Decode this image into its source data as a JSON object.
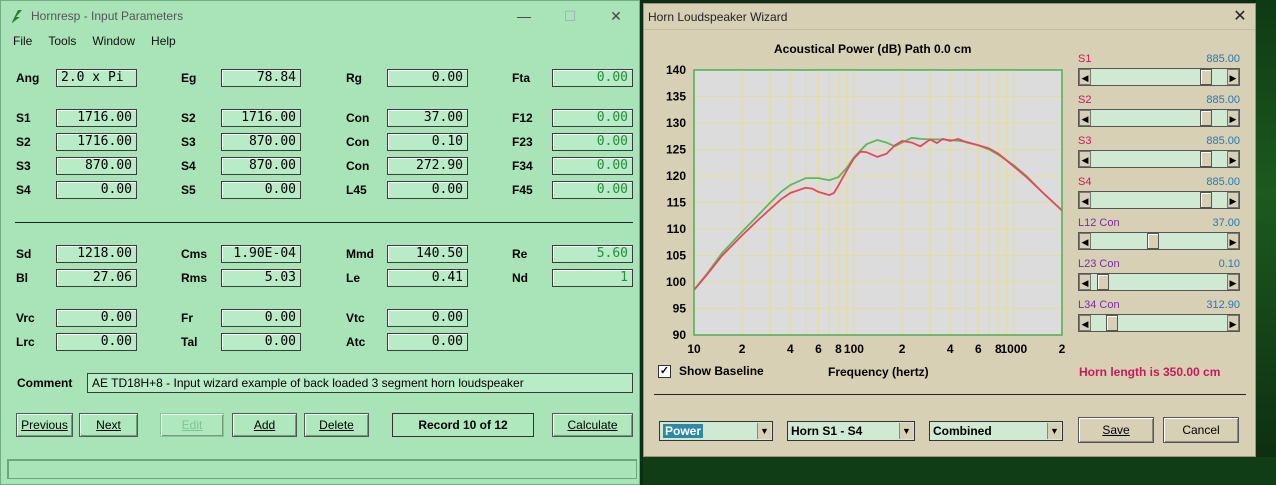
{
  "left_window": {
    "title": "Hornresp - Input Parameters",
    "controls": {
      "minimize": "—",
      "maximize": "☐",
      "close": "✕"
    },
    "menu": [
      "File",
      "Tools",
      "Window",
      "Help"
    ],
    "fields": [
      {
        "label": "Ang",
        "value": "2.0 x Pi"
      },
      {
        "label": "Eg",
        "value": "78.84"
      },
      {
        "label": "Rg",
        "value": "0.00"
      },
      {
        "label": "Fta",
        "value": "0.00"
      },
      {
        "label": "S1",
        "value": "1716.00"
      },
      {
        "label": "S2",
        "value": "1716.00"
      },
      {
        "label": "Con",
        "value": "37.00"
      },
      {
        "label": "F12",
        "value": "0.00"
      },
      {
        "label": "S2",
        "value": "1716.00"
      },
      {
        "label": "S3",
        "value": "870.00"
      },
      {
        "label": "Con",
        "value": "0.10"
      },
      {
        "label": "F23",
        "value": "0.00"
      },
      {
        "label": "S3",
        "value": "870.00"
      },
      {
        "label": "S4",
        "value": "870.00"
      },
      {
        "label": "Con",
        "value": "272.90"
      },
      {
        "label": "F34",
        "value": "0.00"
      },
      {
        "label": "S4",
        "value": "0.00"
      },
      {
        "label": "S5",
        "value": "0.00"
      },
      {
        "label": "L45",
        "value": "0.00"
      },
      {
        "label": "F45",
        "value": "0.00"
      },
      {
        "label": "Sd",
        "value": "1218.00"
      },
      {
        "label": "Cms",
        "value": "1.90E-04"
      },
      {
        "label": "Mmd",
        "value": "140.50"
      },
      {
        "label": "Re",
        "value": "5.60"
      },
      {
        "label": "Bl",
        "value": "27.06"
      },
      {
        "label": "Rms",
        "value": "5.03"
      },
      {
        "label": "Le",
        "value": "0.41"
      },
      {
        "label": "Nd",
        "value": "1"
      },
      {
        "label": "Vrc",
        "value": "0.00"
      },
      {
        "label": "Fr",
        "value": "0.00"
      },
      {
        "label": "Vtc",
        "value": "0.00"
      },
      {
        "label": "Lrc",
        "value": "0.00"
      },
      {
        "label": "Tal",
        "value": "0.00"
      },
      {
        "label": "Atc",
        "value": "0.00"
      }
    ],
    "comment_label": "Comment",
    "comment": "AE TD18H+8 - Input wizard example of back loaded 3 segment horn loudspeaker",
    "buttons": {
      "previous": "Previous",
      "next": "Next",
      "edit": "Edit",
      "add": "Add",
      "delete": "Delete",
      "calculate": "Calculate"
    },
    "record": "Record 10 of 12"
  },
  "right_window": {
    "title": "Horn Loudspeaker Wizard",
    "close": "✕",
    "chart_heading": "Acoustical Power (dB)   Path 0.0 cm",
    "show_baseline": "Show Baseline",
    "show_baseline_checked": "✓",
    "frequency_label": "Frequency (hertz)",
    "horn_length": "Horn length is 350.00 cm",
    "sliders": [
      {
        "label": "S1",
        "value": "885.00",
        "position": 0.88
      },
      {
        "label": "S2",
        "value": "885.00",
        "position": 0.88
      },
      {
        "label": "S3",
        "value": "885.00",
        "position": 0.88
      },
      {
        "label": "S4",
        "value": "885.00",
        "position": 0.88
      },
      {
        "label": "L12  Con",
        "value": "37.00",
        "position": 0.45
      },
      {
        "label": "L23  Con",
        "value": "0.10",
        "position": 0.05
      },
      {
        "label": "L34  Con",
        "value": "312.90",
        "position": 0.12
      }
    ],
    "combos": {
      "plot": "Power",
      "section": "Horn S1 - S4",
      "mode": "Combined"
    },
    "buttons": {
      "save": "Save",
      "cancel": "Cancel"
    },
    "arrows": {
      "left": "◀",
      "right": "▶",
      "down": "▼"
    },
    "colors": {
      "series_green": "#5cb85c",
      "series_red": "#e8465a",
      "grid": "#e4dc9c",
      "plot_bg": "#dcdcdc",
      "frame": "#4caf50"
    }
  },
  "chart_data": {
    "type": "line",
    "xscale": "log",
    "xlim": [
      10,
      2000
    ],
    "ylim": [
      90,
      140
    ],
    "xticks": [
      {
        "v": 10,
        "label": "10"
      },
      {
        "v": 20,
        "label": "2"
      },
      {
        "v": 40,
        "label": "4"
      },
      {
        "v": 60,
        "label": "6"
      },
      {
        "v": 80,
        "label": "8"
      },
      {
        "v": 100,
        "label": "100"
      },
      {
        "v": 200,
        "label": "2"
      },
      {
        "v": 400,
        "label": "4"
      },
      {
        "v": 600,
        "label": "6"
      },
      {
        "v": 800,
        "label": "8"
      },
      {
        "v": 1000,
        "label": "1000"
      },
      {
        "v": 2000,
        "label": "2"
      }
    ],
    "yticks": [
      90,
      95,
      100,
      105,
      110,
      115,
      120,
      125,
      130,
      135,
      140
    ],
    "series": [
      {
        "color": "#5cb85c",
        "points": [
          [
            10,
            98.5
          ],
          [
            12,
            101.5
          ],
          [
            15,
            105.5
          ],
          [
            20,
            109.5
          ],
          [
            25,
            112.5
          ],
          [
            30,
            115
          ],
          [
            35,
            117
          ],
          [
            40,
            118.3
          ],
          [
            50,
            119.6
          ],
          [
            60,
            119.6
          ],
          [
            70,
            119.2
          ],
          [
            80,
            119.8
          ],
          [
            90,
            121.5
          ],
          [
            100,
            123.5
          ],
          [
            120,
            126
          ],
          [
            140,
            126.8
          ],
          [
            160,
            126.3
          ],
          [
            180,
            125.6
          ],
          [
            200,
            126.3
          ],
          [
            230,
            127.2
          ],
          [
            260,
            127
          ],
          [
            300,
            126.9
          ],
          [
            350,
            126.9
          ],
          [
            400,
            126.8
          ],
          [
            500,
            126.5
          ],
          [
            600,
            125.8
          ],
          [
            700,
            125
          ],
          [
            800,
            124
          ],
          [
            1000,
            122
          ],
          [
            1200,
            120
          ],
          [
            1500,
            117
          ],
          [
            2000,
            113.5
          ]
        ]
      },
      {
        "color": "#e8465a",
        "points": [
          [
            10,
            98.5
          ],
          [
            12,
            101.3
          ],
          [
            15,
            105
          ],
          [
            20,
            108.8
          ],
          [
            25,
            111.6
          ],
          [
            30,
            113.8
          ],
          [
            35,
            115.6
          ],
          [
            40,
            116.8
          ],
          [
            50,
            117.8
          ],
          [
            55,
            117.6
          ],
          [
            60,
            117
          ],
          [
            70,
            116.4
          ],
          [
            75,
            116.8
          ],
          [
            80,
            118.2
          ],
          [
            90,
            121
          ],
          [
            100,
            123.3
          ],
          [
            110,
            124.6
          ],
          [
            120,
            124.5
          ],
          [
            140,
            123.6
          ],
          [
            160,
            124.2
          ],
          [
            180,
            125.8
          ],
          [
            200,
            126.6
          ],
          [
            230,
            126.3
          ],
          [
            260,
            125.6
          ],
          [
            300,
            126.9
          ],
          [
            330,
            126.2
          ],
          [
            360,
            127
          ],
          [
            400,
            126.6
          ],
          [
            450,
            127
          ],
          [
            500,
            126.4
          ],
          [
            600,
            125.8
          ],
          [
            700,
            125.2
          ],
          [
            800,
            124.2
          ],
          [
            1000,
            121.8
          ],
          [
            1200,
            119.8
          ],
          [
            1500,
            117
          ],
          [
            2000,
            113.5
          ]
        ]
      }
    ]
  }
}
